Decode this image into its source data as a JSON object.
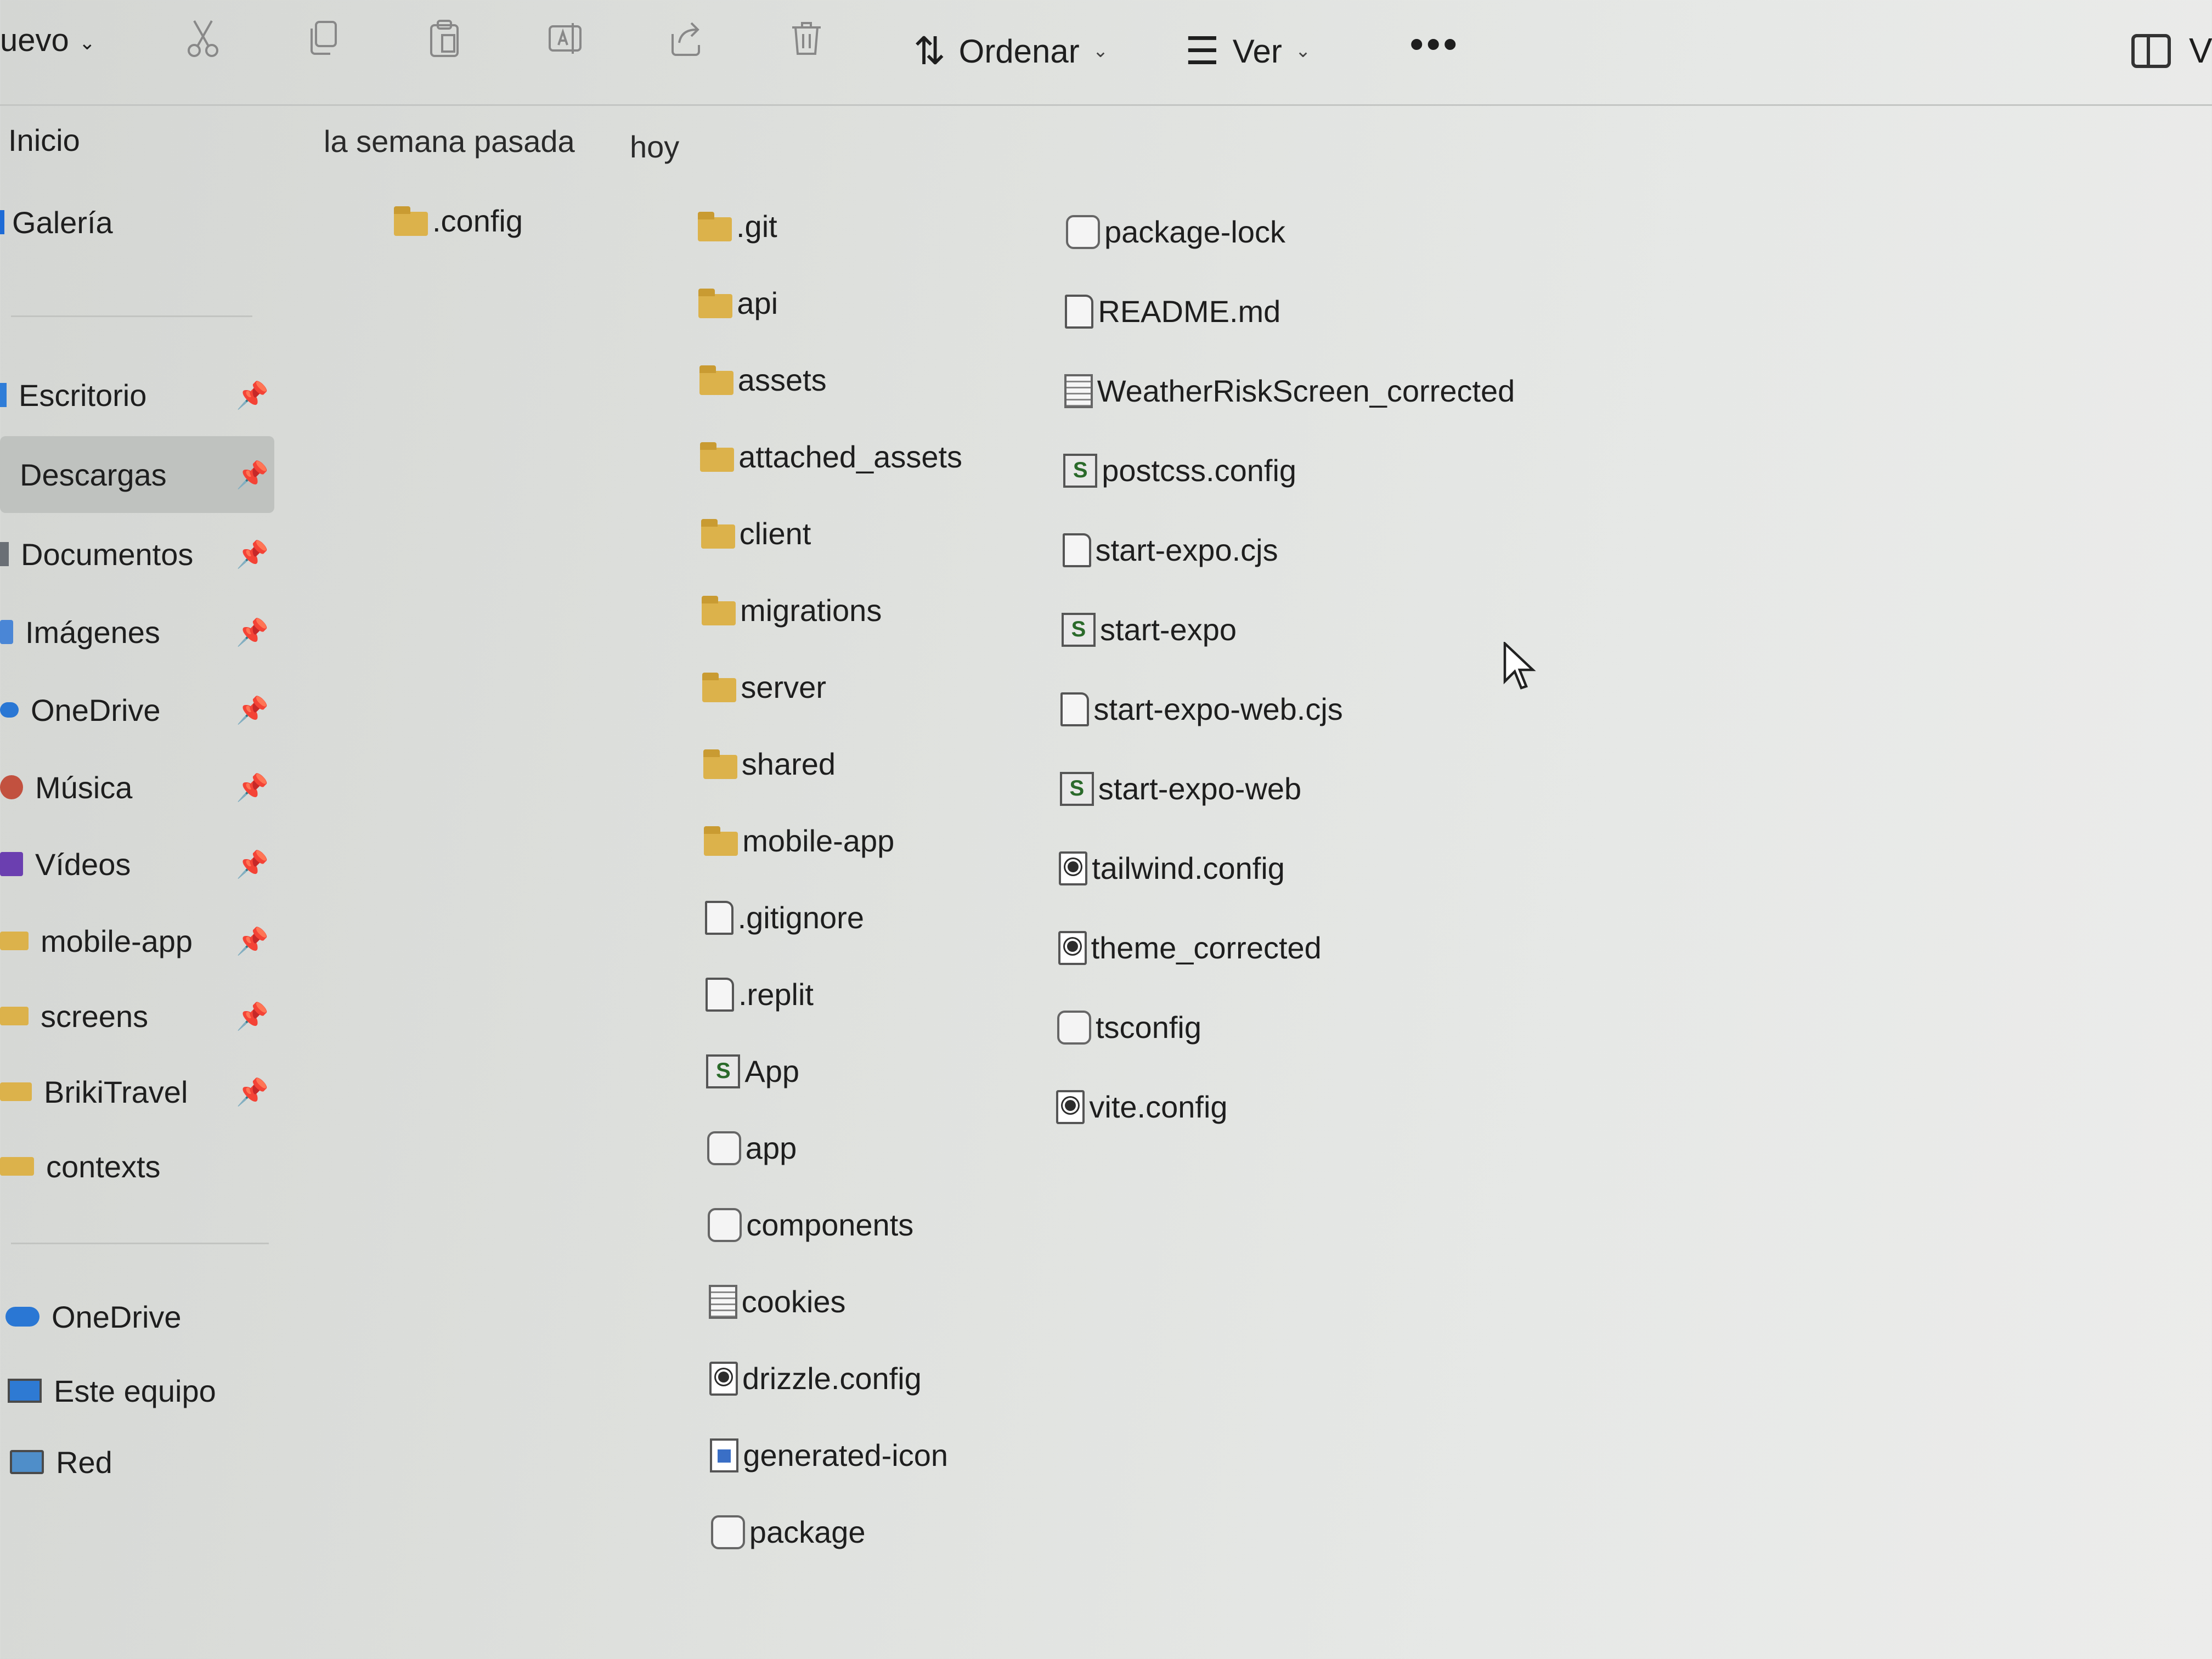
{
  "toolbar": {
    "new_label": "uevo",
    "sort_label": "Ordenar",
    "view_label": "Ver",
    "more_label": "•••",
    "right_label": "V"
  },
  "sidebar": {
    "top": [
      {
        "label": "Inicio",
        "icon": "home-icon"
      },
      {
        "label": "Galería",
        "icon": "gallery-icon"
      }
    ],
    "quick_access": [
      {
        "label": "Escritorio",
        "icon": "desktop-icon",
        "pinned": true
      },
      {
        "label": "Descargas",
        "icon": "download-icon",
        "pinned": true,
        "selected": true
      },
      {
        "label": "Documentos",
        "icon": "documents-icon",
        "pinned": true
      },
      {
        "label": "Imágenes",
        "icon": "pictures-icon",
        "pinned": true
      },
      {
        "label": "OneDrive",
        "icon": "cloud-icon",
        "pinned": true
      },
      {
        "label": "Música",
        "icon": "music-icon",
        "pinned": true
      },
      {
        "label": "Vídeos",
        "icon": "videos-icon",
        "pinned": true
      },
      {
        "label": "mobile-app",
        "icon": "folder-icon",
        "pinned": true
      },
      {
        "label": "screens",
        "icon": "folder-icon",
        "pinned": true
      },
      {
        "label": "BrikiTravel",
        "icon": "folder-icon",
        "pinned": true
      },
      {
        "label": "contexts",
        "icon": "folder-icon",
        "pinned": false
      }
    ],
    "locations": [
      {
        "label": "OneDrive",
        "icon": "cloud-icon"
      },
      {
        "label": "Este equipo",
        "icon": "computer-icon"
      },
      {
        "label": "Red",
        "icon": "network-icon"
      }
    ],
    "pin_glyph": "📌"
  },
  "groups": {
    "last_week": "la semana pasada",
    "today": "hoy"
  },
  "files": {
    "last_week": [
      {
        "name": ".config",
        "type": "folder"
      }
    ],
    "today_col1": [
      {
        "name": ".git",
        "type": "folder"
      },
      {
        "name": "api",
        "type": "folder"
      },
      {
        "name": "assets",
        "type": "folder"
      },
      {
        "name": "attached_assets",
        "type": "folder"
      },
      {
        "name": "client",
        "type": "folder"
      },
      {
        "name": "migrations",
        "type": "folder"
      },
      {
        "name": "server",
        "type": "folder"
      },
      {
        "name": "shared",
        "type": "folder"
      },
      {
        "name": "mobile-app",
        "type": "folder"
      },
      {
        "name": ".gitignore",
        "type": "doc"
      },
      {
        "name": ".replit",
        "type": "doc"
      },
      {
        "name": "App",
        "type": "script"
      },
      {
        "name": "app",
        "type": "json"
      },
      {
        "name": "components",
        "type": "json"
      },
      {
        "name": "cookies",
        "type": "txt"
      },
      {
        "name": "drizzle.config",
        "type": "cfg"
      },
      {
        "name": "generated-icon",
        "type": "img"
      },
      {
        "name": "package",
        "type": "json"
      }
    ],
    "today_col2": [
      {
        "name": "package-lock",
        "type": "json"
      },
      {
        "name": "README.md",
        "type": "doc"
      },
      {
        "name": "WeatherRiskScreen_corrected",
        "type": "txt"
      },
      {
        "name": "postcss.config",
        "type": "script"
      },
      {
        "name": "start-expo.cjs",
        "type": "doc"
      },
      {
        "name": "start-expo",
        "type": "script"
      },
      {
        "name": "start-expo-web.cjs",
        "type": "doc"
      },
      {
        "name": "start-expo-web",
        "type": "script"
      },
      {
        "name": "tailwind.config",
        "type": "cfg"
      },
      {
        "name": "theme_corrected",
        "type": "cfg"
      },
      {
        "name": "tsconfig",
        "type": "json"
      },
      {
        "name": "vite.config",
        "type": "cfg"
      }
    ]
  }
}
